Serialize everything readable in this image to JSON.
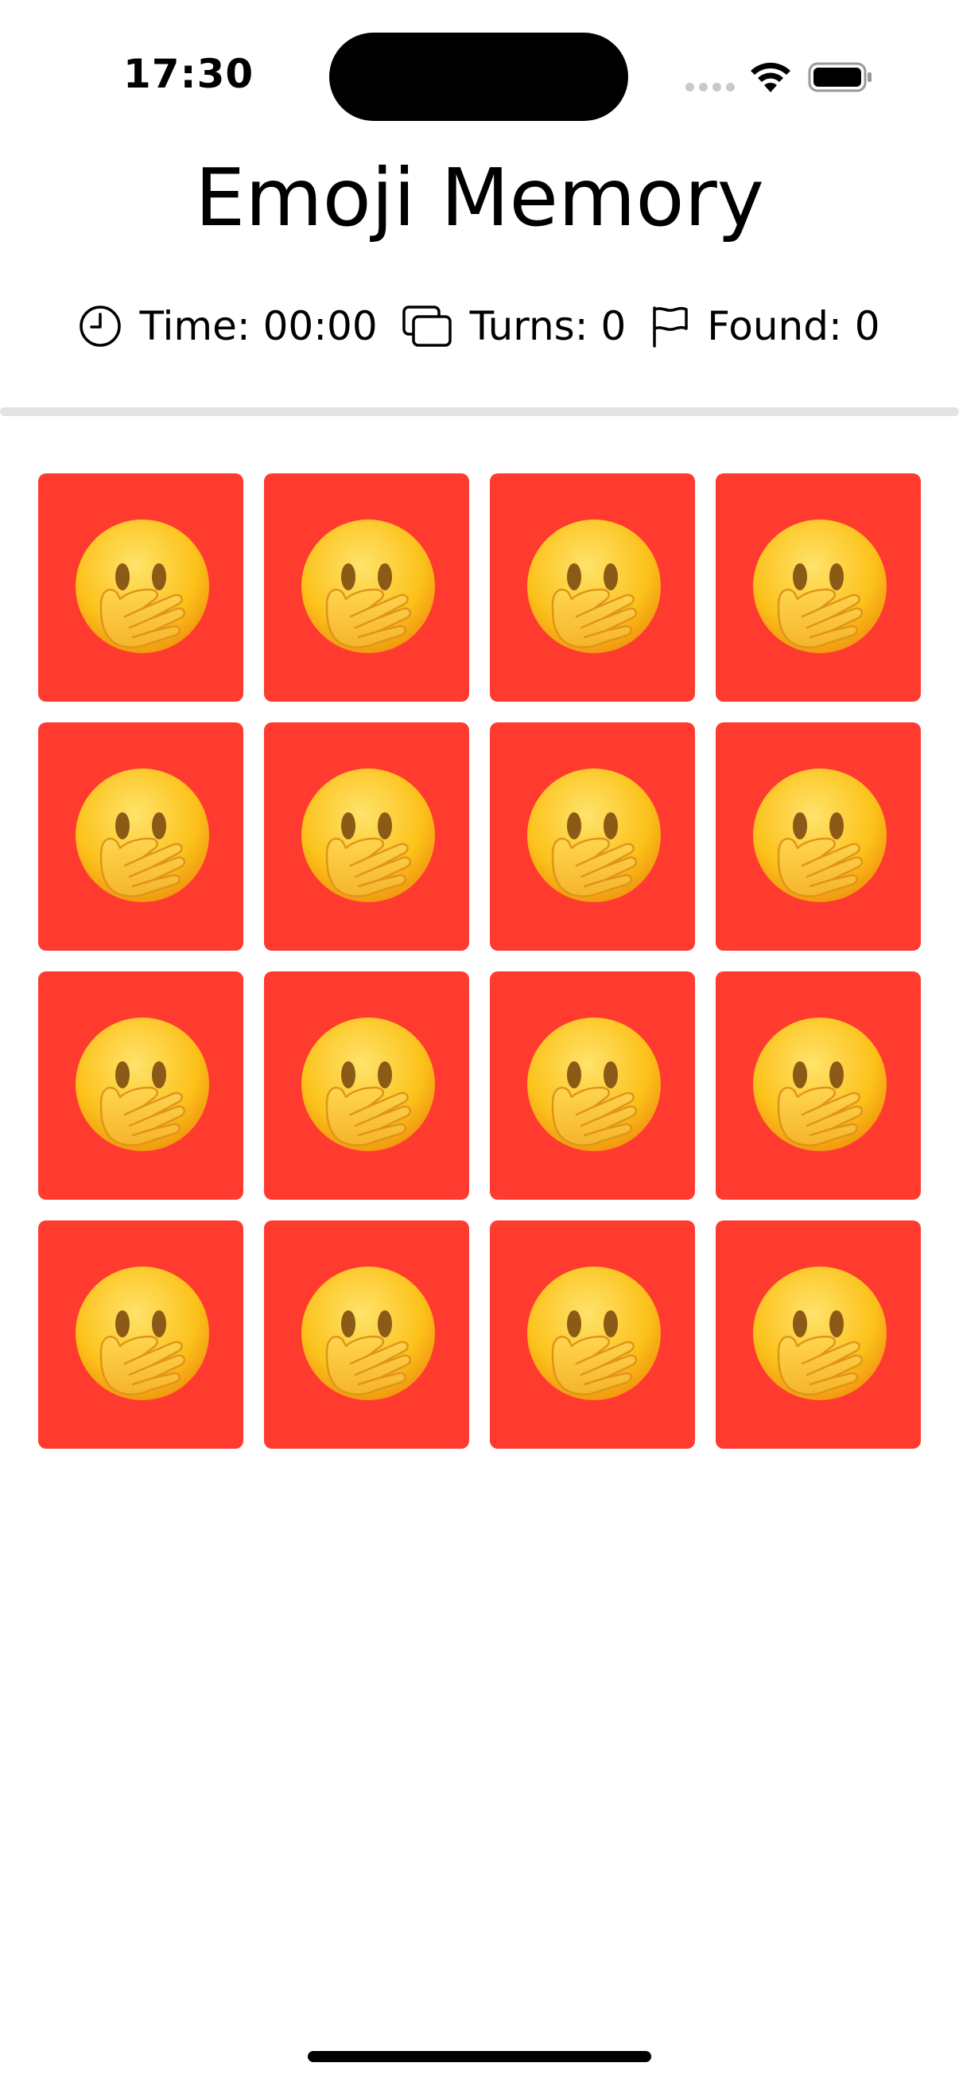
{
  "status_bar": {
    "time": "17:30"
  },
  "header": {
    "title": "Emoji Memory"
  },
  "stats": {
    "time_label": "Time: 00:00",
    "turns_label": "Turns: 0",
    "found_label": "Found: 0",
    "time_icon": "clock-icon",
    "turns_icon": "cards-icon",
    "found_icon": "flag-icon"
  },
  "board": {
    "rows": 4,
    "columns": 4,
    "card_back_color": "#ff3b30",
    "card_back_face": "face-with-hand-over-mouth-emoji",
    "cards": [
      {
        "state": "face-down"
      },
      {
        "state": "face-down"
      },
      {
        "state": "face-down"
      },
      {
        "state": "face-down"
      },
      {
        "state": "face-down"
      },
      {
        "state": "face-down"
      },
      {
        "state": "face-down"
      },
      {
        "state": "face-down"
      },
      {
        "state": "face-down"
      },
      {
        "state": "face-down"
      },
      {
        "state": "face-down"
      },
      {
        "state": "face-down"
      },
      {
        "state": "face-down"
      },
      {
        "state": "face-down"
      },
      {
        "state": "face-down"
      },
      {
        "state": "face-down"
      }
    ]
  },
  "colors": {
    "accent": "#ff3b30",
    "divider": "#e3e3e3",
    "text": "#000000"
  }
}
